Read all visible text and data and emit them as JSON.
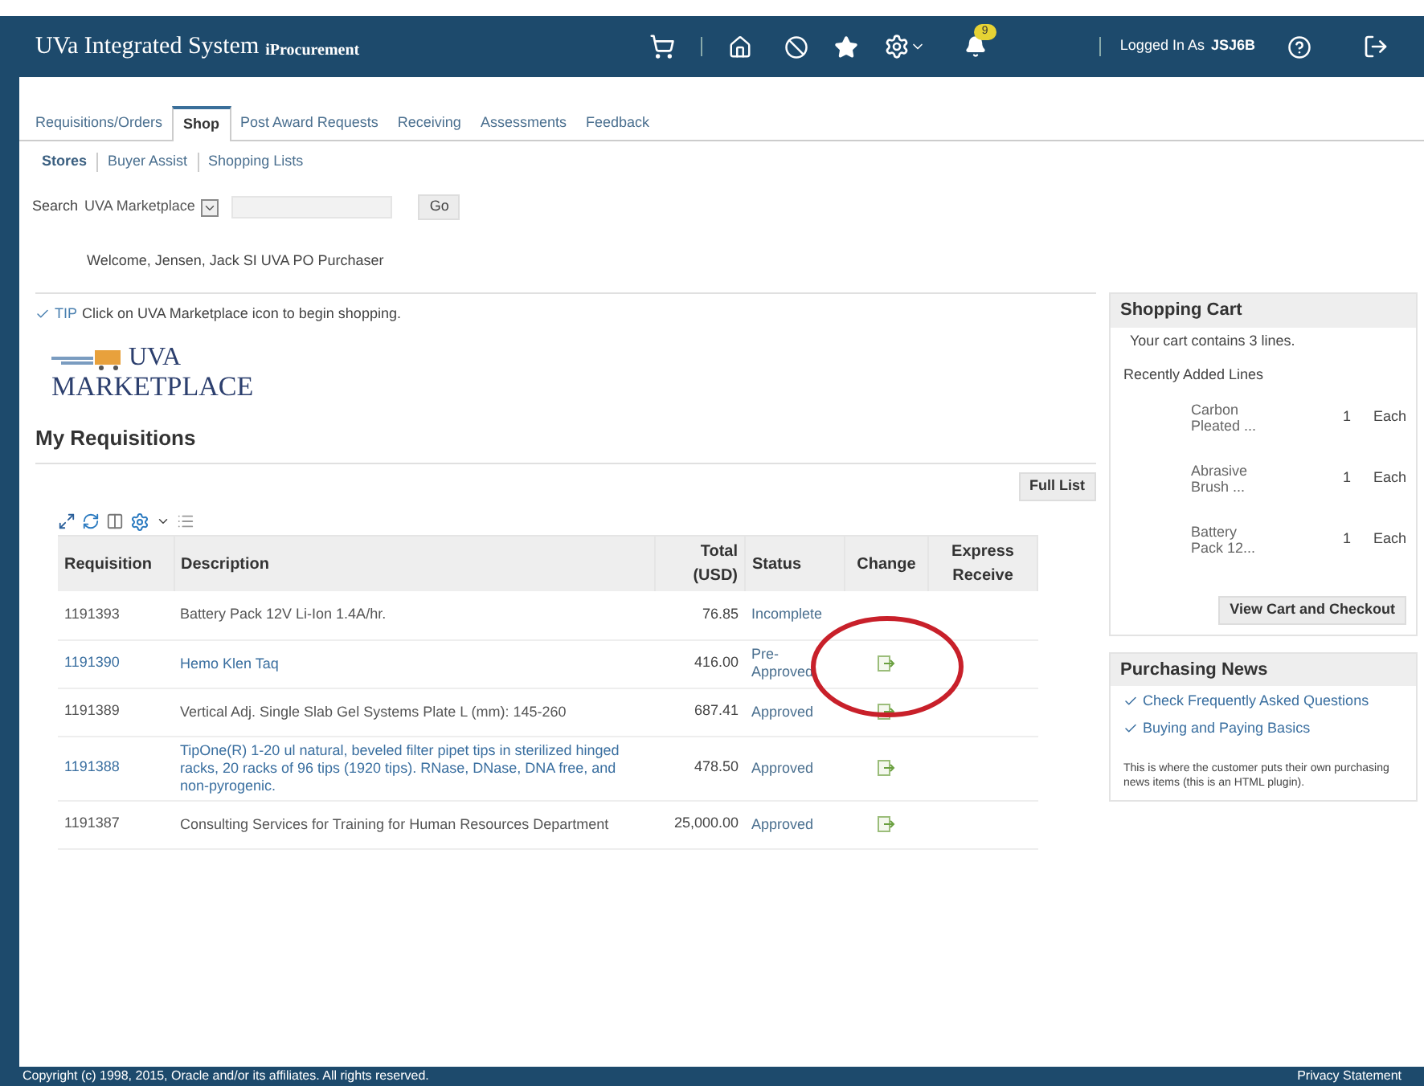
{
  "header": {
    "title": "UVa Integrated System",
    "subtitle": "iProcurement",
    "notification_count": "9",
    "logged_in_label": "Logged In As",
    "user": "JSJ6B"
  },
  "tabs": [
    {
      "label": "Requisitions/Orders",
      "selected": false
    },
    {
      "label": "Shop",
      "selected": true
    },
    {
      "label": "Post Award Requests",
      "selected": false
    },
    {
      "label": "Receiving",
      "selected": false
    },
    {
      "label": "Assessments",
      "selected": false
    },
    {
      "label": "Feedback",
      "selected": false
    }
  ],
  "subtabs": [
    {
      "label": "Stores",
      "selected": true
    },
    {
      "label": "Buyer Assist",
      "selected": false
    },
    {
      "label": "Shopping Lists",
      "selected": false
    }
  ],
  "search": {
    "label": "Search",
    "scope": "UVA Marketplace",
    "button": "Go"
  },
  "welcome": "Welcome, Jensen, Jack SI UVA PO Purchaser",
  "tip": {
    "label": "TIP",
    "text": "Click on UVA Marketplace icon to begin shopping."
  },
  "logo": {
    "line1": "UVA",
    "line2": "MARKETPLACE"
  },
  "requisitions": {
    "title": "My Requisitions",
    "full_list_button": "Full List",
    "columns": [
      "Requisition",
      "Description",
      "Total (USD)",
      "Status",
      "Change",
      "Express Receive"
    ],
    "rows": [
      {
        "requisition": "1191393",
        "description": "Battery Pack 12V Li-Ion 1.4A/hr.",
        "total": "76.85",
        "status": "Incomplete",
        "link": false,
        "changeable": false
      },
      {
        "requisition": "1191390",
        "description": "Hemo Klen Taq",
        "total": "416.00",
        "status": "Pre-Approved",
        "link": true,
        "changeable": true
      },
      {
        "requisition": "1191389",
        "description": "Vertical Adj. Single Slab Gel Systems Plate L (mm): 145-260",
        "total": "687.41",
        "status": "Approved",
        "link": false,
        "changeable": true
      },
      {
        "requisition": "1191388",
        "description": "TipOne(R) 1-20 ul natural, beveled filter pipet tips in sterilized hinged racks, 20 racks of 96 tips (1920 tips). RNase, DNase, DNA free, and non-pyrogenic.",
        "total": "478.50",
        "status": "Approved",
        "link": true,
        "changeable": true
      },
      {
        "requisition": "1191387",
        "description": "Consulting Services for Training for Human Resources Department",
        "total": "25,000.00",
        "status": "Approved",
        "link": false,
        "changeable": true
      }
    ]
  },
  "cart": {
    "title": "Shopping Cart",
    "summary": "Your cart contains 3 lines.",
    "recent_label": "Recently Added Lines",
    "items": [
      {
        "name": "Carbon Pleated ...",
        "qty": "1",
        "unit": "Each"
      },
      {
        "name": "Abrasive Brush ...",
        "qty": "1",
        "unit": "Each"
      },
      {
        "name": "Battery Pack 12...",
        "qty": "1",
        "unit": "Each"
      }
    ],
    "button": "View Cart and Checkout"
  },
  "news": {
    "title": "Purchasing News",
    "links": [
      "Check Frequently Asked Questions",
      "Buying and Paying Basics"
    ],
    "note": "This is where the customer puts their own purchasing news items (this is an HTML plugin)."
  },
  "footer": {
    "copyright": "Copyright (c) 1998, 2015, Oracle and/or its affiliates. All rights reserved.",
    "privacy": "Privacy Statement"
  }
}
